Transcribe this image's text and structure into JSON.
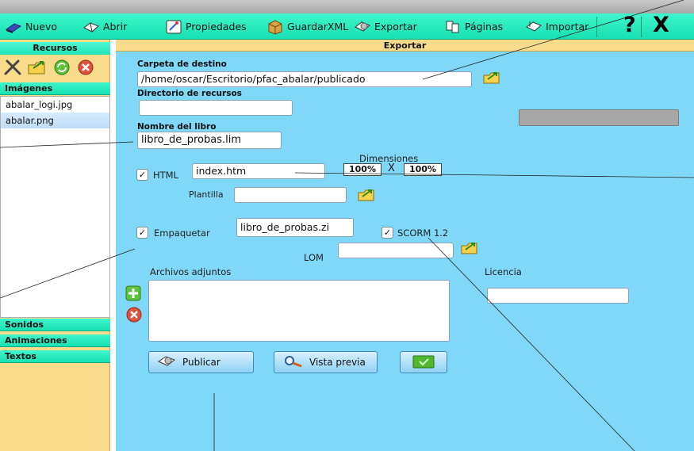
{
  "window": {
    "title": ""
  },
  "toolbar": {
    "nuevo": "Nuevo",
    "abrir": "Abrir",
    "propiedades": "Propiedades",
    "guardar_xml": "GuardarXML",
    "exportar": "Exportar",
    "paginas": "Páginas",
    "importar": "Importar",
    "help_label": "?",
    "close_label": "X"
  },
  "sidebar": {
    "title": "Recursos",
    "images_header": "Imágenes",
    "files": [
      "abalar_logi.jpg",
      "abalar.png"
    ],
    "selected_index": 1,
    "sections": [
      "Sonidos",
      "Animaciones",
      "Textos"
    ]
  },
  "export": {
    "title": "Exportar",
    "destination_label": "Carpeta de destino",
    "destination_value": "/home/oscar/Escritorio/pfac_abalar/publicado",
    "resources_label": "Directorio de recursos",
    "resources_value": "",
    "book_name_label": "Nombre del libro",
    "book_name_value": "libro_de_probas.lim",
    "html_label": "HTML",
    "html_checked": true,
    "html_value": "index.htm",
    "dimensions_label": "Dimensiones",
    "width_value": "100%",
    "x_label": "X",
    "height_value": "100%",
    "template_label": "Plantilla",
    "template_value": "",
    "package_label": "Empaquetar",
    "package_checked": true,
    "package_value": "libro_de_probas.zi",
    "scorm_label": "SCORM 1.2",
    "scorm_checked": true,
    "lom_label": "LOM",
    "lom_value": "",
    "attachments_label": "Archivos adjuntos",
    "license_label": "Licencia",
    "license_value": "",
    "publish_button": "Publicar",
    "preview_button": "Vista previa"
  },
  "colors": {
    "toolbar": "#22e8ba",
    "sidebar": "#f8dc8c",
    "main": "#7fd8f7"
  }
}
